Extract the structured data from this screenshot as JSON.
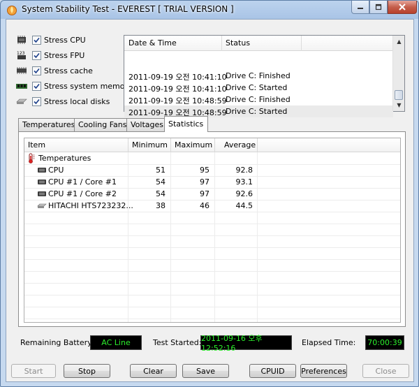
{
  "window": {
    "title": "System Stability Test - EVEREST  [ TRIAL VERSION ]"
  },
  "stress_options": [
    {
      "label": "Stress CPU",
      "checked": true,
      "icon": "cpu-chip-icon"
    },
    {
      "label": "Stress FPU",
      "checked": true,
      "icon": "fpu-icon"
    },
    {
      "label": "Stress cache",
      "checked": true,
      "icon": "cache-chip-icon"
    },
    {
      "label": "Stress system memory",
      "checked": true,
      "icon": "memory-module-icon"
    },
    {
      "label": "Stress local disks",
      "checked": true,
      "icon": "hard-disk-icon"
    }
  ],
  "log": {
    "headers": {
      "datetime": "Date & Time",
      "status": "Status"
    },
    "rows": [
      {
        "datetime": "2011-09-19 오전 10:41:10",
        "status": "Drive C: Finished"
      },
      {
        "datetime": "2011-09-19 오전 10:41:10",
        "status": "Drive C: Started"
      },
      {
        "datetime": "2011-09-19 오전 10:48:59",
        "status": "Drive C: Finished"
      },
      {
        "datetime": "2011-09-19 오전 10:48:59",
        "status": "Drive C: Started"
      }
    ]
  },
  "tabs": [
    {
      "label": "Temperatures",
      "active": false
    },
    {
      "label": "Cooling Fans",
      "active": false
    },
    {
      "label": "Voltages",
      "active": false
    },
    {
      "label": "Statistics",
      "active": true
    }
  ],
  "statistics": {
    "headers": {
      "item": "Item",
      "minimum": "Minimum",
      "maximum": "Maximum",
      "average": "Average"
    },
    "group": "Temperatures",
    "rows": [
      {
        "item": "CPU",
        "minimum": "51",
        "maximum": "95",
        "average": "92.8",
        "icon": "cpu-icon"
      },
      {
        "item": "CPU #1 / Core #1",
        "minimum": "54",
        "maximum": "97",
        "average": "93.1",
        "icon": "cpu-icon"
      },
      {
        "item": "CPU #1 / Core #2",
        "minimum": "54",
        "maximum": "97",
        "average": "92.6",
        "icon": "cpu-icon"
      },
      {
        "item": "HITACHI HTS723232...",
        "minimum": "38",
        "maximum": "46",
        "average": "44.5",
        "icon": "hard-disk-icon"
      }
    ]
  },
  "status_bar": {
    "battery_label": "Remaining Battery:",
    "battery_value": "AC Line",
    "started_label": "Test Started:",
    "started_value": "2011-09-16 오후 12:52:16",
    "elapsed_label": "Elapsed Time:",
    "elapsed_value": "70:00:39"
  },
  "buttons": {
    "start": "Start",
    "stop": "Stop",
    "clear": "Clear",
    "save": "Save",
    "cpuid": "CPUID",
    "preferences": "Preferences",
    "close": "Close"
  },
  "colors": {
    "lcd_text": "#2cf02c",
    "lcd_background": "#000000",
    "titlebar": "#a9c4e6",
    "close_button": "#c45f4c"
  }
}
